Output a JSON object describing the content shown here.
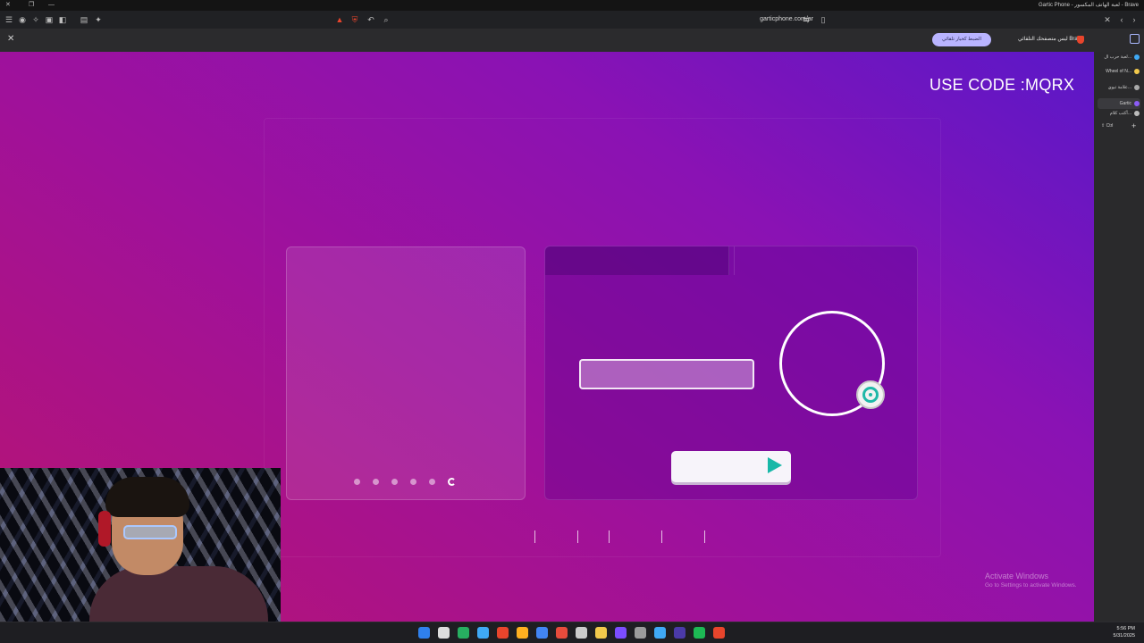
{
  "window": {
    "title": "Gartic Phone - لعبة الهاتف المكسور - Brave"
  },
  "toolbar": {
    "url": "garticphone.com/ar"
  },
  "infobar": {
    "message": "Brave ليس متصفحك التلقائي",
    "button_label": "الضبط كخيار تلقائي"
  },
  "overlay": {
    "code_text": "USE CODE :MQRX"
  },
  "watermark": {
    "line1": "Activate Windows",
    "line2": "Go to Settings to activate Windows."
  },
  "sidebar_tabs": [
    {
      "label": "لعبة حرب ال...",
      "favicon_color": "#3fa9f5"
    },
    {
      "label": "Wheel of N...",
      "favicon_color": "#f2c94c"
    },
    {
      "label": "علامة تبوي...",
      "favicon_color": "#aaaaaa"
    },
    {
      "label": "Gartic",
      "favicon_color": "#8b5cf6"
    },
    {
      "label": "أكتب كلام...",
      "favicon_color": "#bbbbbb"
    }
  ],
  "sidebar": {
    "ctrl_hint": "⇧ Ctrl"
  },
  "taskbar": {
    "time": "5:56 PM",
    "date": "5/31/2025",
    "icon_colors": [
      "#2f80ed",
      "#dddddd",
      "#27ae60",
      "#3fa9f5",
      "#e8452c",
      "#ffb020",
      "#4285f4",
      "#e74c3c",
      "#cccccc",
      "#f2c94c",
      "#7c4dff",
      "#9b9b9b",
      "#3fa9f5",
      "#4b3aa9",
      "#1db954",
      "#e8452c"
    ]
  },
  "game": {
    "carousel_dots": 5,
    "carousel_active": 6
  }
}
